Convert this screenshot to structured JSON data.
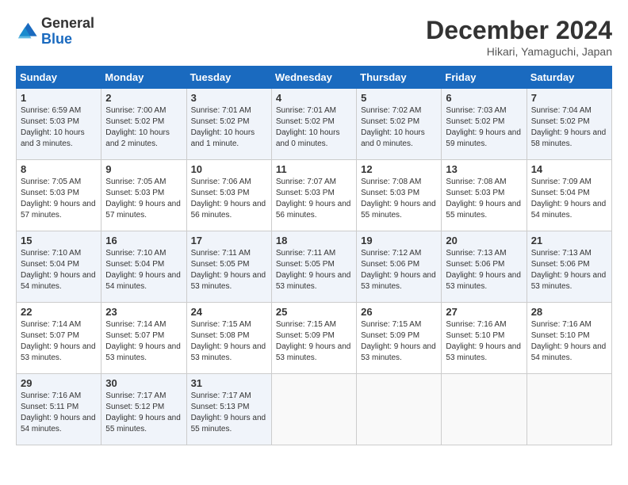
{
  "header": {
    "logo_general": "General",
    "logo_blue": "Blue",
    "month_year": "December 2024",
    "location": "Hikari, Yamaguchi, Japan"
  },
  "weekdays": [
    "Sunday",
    "Monday",
    "Tuesday",
    "Wednesday",
    "Thursday",
    "Friday",
    "Saturday"
  ],
  "weeks": [
    [
      {
        "day": "1",
        "sunrise": "6:59 AM",
        "sunset": "5:03 PM",
        "daylight": "10 hours and 3 minutes."
      },
      {
        "day": "2",
        "sunrise": "7:00 AM",
        "sunset": "5:02 PM",
        "daylight": "10 hours and 2 minutes."
      },
      {
        "day": "3",
        "sunrise": "7:01 AM",
        "sunset": "5:02 PM",
        "daylight": "10 hours and 1 minute."
      },
      {
        "day": "4",
        "sunrise": "7:01 AM",
        "sunset": "5:02 PM",
        "daylight": "10 hours and 0 minutes."
      },
      {
        "day": "5",
        "sunrise": "7:02 AM",
        "sunset": "5:02 PM",
        "daylight": "10 hours and 0 minutes."
      },
      {
        "day": "6",
        "sunrise": "7:03 AM",
        "sunset": "5:02 PM",
        "daylight": "9 hours and 59 minutes."
      },
      {
        "day": "7",
        "sunrise": "7:04 AM",
        "sunset": "5:02 PM",
        "daylight": "9 hours and 58 minutes."
      }
    ],
    [
      {
        "day": "8",
        "sunrise": "7:05 AM",
        "sunset": "5:03 PM",
        "daylight": "9 hours and 57 minutes."
      },
      {
        "day": "9",
        "sunrise": "7:05 AM",
        "sunset": "5:03 PM",
        "daylight": "9 hours and 57 minutes."
      },
      {
        "day": "10",
        "sunrise": "7:06 AM",
        "sunset": "5:03 PM",
        "daylight": "9 hours and 56 minutes."
      },
      {
        "day": "11",
        "sunrise": "7:07 AM",
        "sunset": "5:03 PM",
        "daylight": "9 hours and 56 minutes."
      },
      {
        "day": "12",
        "sunrise": "7:08 AM",
        "sunset": "5:03 PM",
        "daylight": "9 hours and 55 minutes."
      },
      {
        "day": "13",
        "sunrise": "7:08 AM",
        "sunset": "5:03 PM",
        "daylight": "9 hours and 55 minutes."
      },
      {
        "day": "14",
        "sunrise": "7:09 AM",
        "sunset": "5:04 PM",
        "daylight": "9 hours and 54 minutes."
      }
    ],
    [
      {
        "day": "15",
        "sunrise": "7:10 AM",
        "sunset": "5:04 PM",
        "daylight": "9 hours and 54 minutes."
      },
      {
        "day": "16",
        "sunrise": "7:10 AM",
        "sunset": "5:04 PM",
        "daylight": "9 hours and 54 minutes."
      },
      {
        "day": "17",
        "sunrise": "7:11 AM",
        "sunset": "5:05 PM",
        "daylight": "9 hours and 53 minutes."
      },
      {
        "day": "18",
        "sunrise": "7:11 AM",
        "sunset": "5:05 PM",
        "daylight": "9 hours and 53 minutes."
      },
      {
        "day": "19",
        "sunrise": "7:12 AM",
        "sunset": "5:06 PM",
        "daylight": "9 hours and 53 minutes."
      },
      {
        "day": "20",
        "sunrise": "7:13 AM",
        "sunset": "5:06 PM",
        "daylight": "9 hours and 53 minutes."
      },
      {
        "day": "21",
        "sunrise": "7:13 AM",
        "sunset": "5:06 PM",
        "daylight": "9 hours and 53 minutes."
      }
    ],
    [
      {
        "day": "22",
        "sunrise": "7:14 AM",
        "sunset": "5:07 PM",
        "daylight": "9 hours and 53 minutes."
      },
      {
        "day": "23",
        "sunrise": "7:14 AM",
        "sunset": "5:07 PM",
        "daylight": "9 hours and 53 minutes."
      },
      {
        "day": "24",
        "sunrise": "7:15 AM",
        "sunset": "5:08 PM",
        "daylight": "9 hours and 53 minutes."
      },
      {
        "day": "25",
        "sunrise": "7:15 AM",
        "sunset": "5:09 PM",
        "daylight": "9 hours and 53 minutes."
      },
      {
        "day": "26",
        "sunrise": "7:15 AM",
        "sunset": "5:09 PM",
        "daylight": "9 hours and 53 minutes."
      },
      {
        "day": "27",
        "sunrise": "7:16 AM",
        "sunset": "5:10 PM",
        "daylight": "9 hours and 53 minutes."
      },
      {
        "day": "28",
        "sunrise": "7:16 AM",
        "sunset": "5:10 PM",
        "daylight": "9 hours and 54 minutes."
      }
    ],
    [
      {
        "day": "29",
        "sunrise": "7:16 AM",
        "sunset": "5:11 PM",
        "daylight": "9 hours and 54 minutes."
      },
      {
        "day": "30",
        "sunrise": "7:17 AM",
        "sunset": "5:12 PM",
        "daylight": "9 hours and 55 minutes."
      },
      {
        "day": "31",
        "sunrise": "7:17 AM",
        "sunset": "5:13 PM",
        "daylight": "9 hours and 55 minutes."
      },
      null,
      null,
      null,
      null
    ]
  ]
}
